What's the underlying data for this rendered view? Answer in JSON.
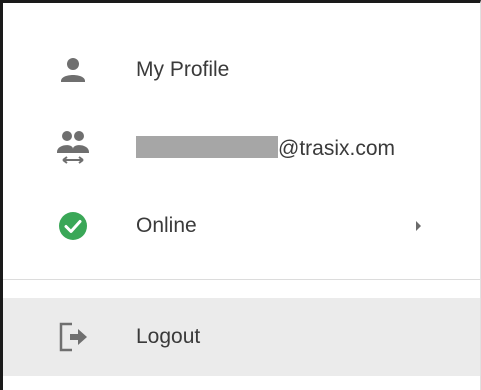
{
  "menu": {
    "items": [
      {
        "label": "My Profile",
        "icon": "person-icon"
      },
      {
        "label": "@trasix.com",
        "icon": "switch-account-icon",
        "redacted": true
      },
      {
        "label": "Online",
        "icon": "online-status-icon",
        "has_submenu": true
      }
    ],
    "logout": {
      "label": "Logout",
      "icon": "logout-icon"
    }
  },
  "colors": {
    "status_online": "#3aa757",
    "icon_gray": "#6f6f6f",
    "highlight_bg": "#ebebeb"
  }
}
